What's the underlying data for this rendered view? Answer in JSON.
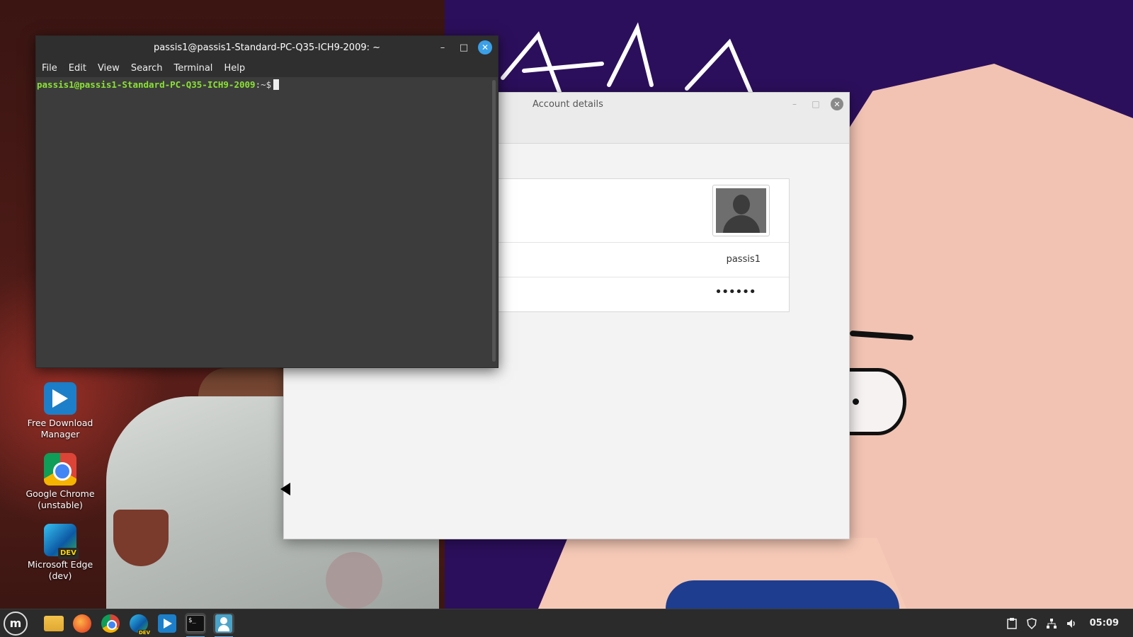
{
  "desktop": {
    "icons": [
      {
        "label_line1": "Free Download",
        "label_line2": "Manager",
        "icon": "fdm-icon"
      },
      {
        "label_line1": "Google Chrome",
        "label_line2": "(unstable)",
        "icon": "chrome-icon"
      },
      {
        "label_line1": "Microsoft Edge",
        "label_line2": "(dev)",
        "icon": "edge-dev-icon"
      }
    ],
    "edge_badge": "DEV"
  },
  "terminal": {
    "title": "passis1@passis1-Standard-PC-Q35-ICH9-2009: ~",
    "menu": [
      "File",
      "Edit",
      "View",
      "Search",
      "Terminal",
      "Help"
    ],
    "prompt_user": "passis1@passis1-Standard-PC-Q35-ICH9-2009",
    "prompt_tail": ":~$",
    "controls": {
      "minimize": "–",
      "maximize": "□",
      "close": "✕"
    }
  },
  "account_window": {
    "title": "Account details",
    "username": "passis1",
    "password_mask": "••••••",
    "controls": {
      "minimize": "–",
      "maximize": "□",
      "close": "✕"
    }
  },
  "taskbar": {
    "menu_glyph": "m",
    "apps": [
      "files-icon",
      "firefox-icon",
      "chrome-icon",
      "edge-dev-icon",
      "fdm-icon",
      "terminal-icon",
      "user-accounts-icon"
    ],
    "terminal_glyph": "$_",
    "edge_badge": "DEV",
    "tray": [
      "clipboard-icon",
      "shield-icon",
      "network-icon",
      "volume-icon"
    ],
    "clock": "05:09"
  },
  "colors": {
    "terminal_bg": "#3c3c3c",
    "prompt_green": "#8ae234",
    "close_blue": "#3aa0e8",
    "taskbar_bg": "#2b2b2b"
  }
}
